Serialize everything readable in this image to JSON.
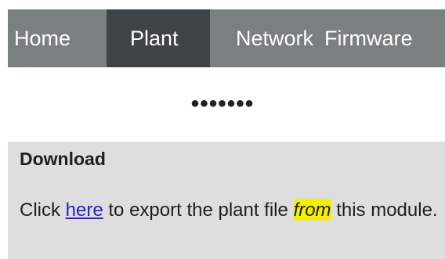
{
  "nav": {
    "items": [
      {
        "label": "Home"
      },
      {
        "label": "Plant"
      },
      {
        "label": "Network"
      },
      {
        "label": "Firmware"
      }
    ]
  },
  "separator": {
    "text": "•••••••"
  },
  "download": {
    "title": "Download",
    "text_before_link": "Click ",
    "link_label": "here",
    "text_middle": " to export the plant file ",
    "highlighted_word": "from",
    "text_after": " this module."
  },
  "colors": {
    "nav_background": "#7a7f80",
    "nav_active_background": "#3e4446",
    "panel_background": "#dedede",
    "link": "#2a1fd0",
    "highlight": "#f5f000"
  }
}
